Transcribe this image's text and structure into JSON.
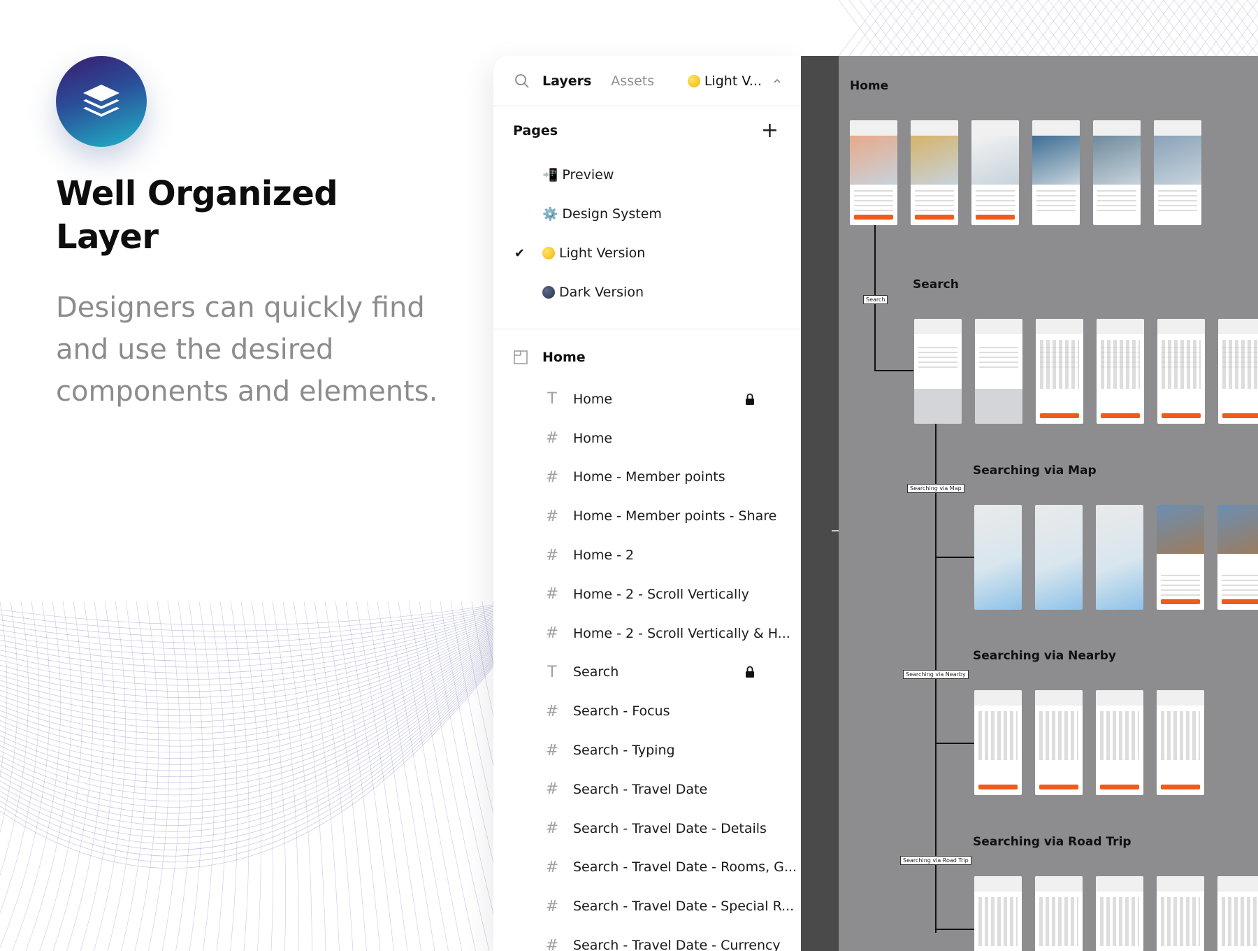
{
  "hero": {
    "headline": "Well Organized Layer",
    "description": "Designers can quickly find and use the desired components and elements.",
    "logo_icon": "stack-layers-icon"
  },
  "panel": {
    "tabs": [
      "Layers",
      "Assets"
    ],
    "active_tab": "Layers",
    "page_selector": "Light V...",
    "pages_title": "Pages",
    "pages": [
      {
        "icon": "📲",
        "label": "Preview",
        "checked": false
      },
      {
        "icon": "⚙️",
        "label": "Design System",
        "checked": false
      },
      {
        "icon": "yellow-dot",
        "label": "Light Version",
        "checked": true
      },
      {
        "icon": "navy-dot",
        "label": "Dark Version",
        "checked": false
      }
    ],
    "frame": "Home",
    "layers": [
      {
        "type": "text",
        "label": "Home",
        "locked": true
      },
      {
        "type": "frame",
        "label": "Home",
        "locked": false
      },
      {
        "type": "frame",
        "label": "Home - Member points",
        "locked": false
      },
      {
        "type": "frame",
        "label": "Home - Member points - Share",
        "locked": false
      },
      {
        "type": "frame",
        "label": "Home - 2",
        "locked": false
      },
      {
        "type": "frame",
        "label": "Home - 2 - Scroll Vertically",
        "locked": false
      },
      {
        "type": "frame",
        "label": "Home - 2 - Scroll Vertically & H...",
        "locked": false
      },
      {
        "type": "text",
        "label": "Search",
        "locked": true
      },
      {
        "type": "frame",
        "label": "Search - Focus",
        "locked": false
      },
      {
        "type": "frame",
        "label": "Search - Typing",
        "locked": false
      },
      {
        "type": "frame",
        "label": "Search - Travel Date",
        "locked": false
      },
      {
        "type": "frame",
        "label": "Search - Travel Date - Details",
        "locked": false
      },
      {
        "type": "frame",
        "label": "Search - Travel Date - Rooms, G...",
        "locked": false
      },
      {
        "type": "frame",
        "label": "Search - Travel Date - Special R...",
        "locked": false
      },
      {
        "type": "frame",
        "label": "Search - Travel Date - Currency",
        "locked": false
      }
    ]
  },
  "canvas": {
    "sections": [
      {
        "title": "Home"
      },
      {
        "title": "Search",
        "flow_label": "Search"
      },
      {
        "title": "Searching via Map",
        "flow_label": "Searching via Map"
      },
      {
        "title": "Searching via Nearby",
        "flow_label": "Searching via Nearby"
      },
      {
        "title": "Searching via Road Trip",
        "flow_label": "Searching via Road Trip"
      }
    ]
  },
  "colors": {
    "accent": "#f05a1a",
    "canvas_bg": "#8d8c8f",
    "mesh": "#8a86c4"
  }
}
